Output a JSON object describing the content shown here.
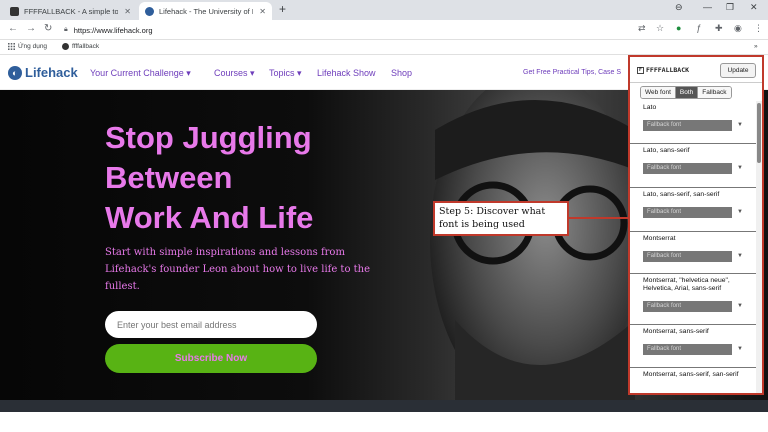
{
  "browser": {
    "tabs": [
      {
        "title": "FFFFALLBACK - A simple tool for",
        "close": "✕"
      },
      {
        "title": "Lifehack - The University of Life",
        "close": "✕"
      }
    ],
    "new_tab": "+",
    "window_controls": [
      "⊖",
      "—",
      "❐",
      "✕"
    ],
    "url": "https://www.lifehack.org",
    "bookmarks": [
      {
        "label": "Ứng dụng"
      },
      {
        "label": "ffffallback"
      }
    ],
    "bookmarks_more": "»"
  },
  "site": {
    "logo_text": "Lifehack",
    "nav": [
      "Your Current Challenge ▾",
      "Courses ▾",
      "Topics ▾",
      "Lifehack Show",
      "Shop"
    ],
    "promo": "Get Free Practical Tips, Case S"
  },
  "hero": {
    "headline": [
      "Stop Juggling",
      "Between",
      "Work And Life"
    ],
    "lead": "Start with simple inspirations and lessons from Lifehack's founder Leon about how to live life to the fullest.",
    "email_placeholder": "Enter your best email address",
    "subscribe": "Subscribe Now"
  },
  "callout": {
    "text": "Step 5: Discover what font is being used"
  },
  "extension": {
    "title": "FFFFALLBACK",
    "update": "Update",
    "tabs": [
      {
        "label": "Web font"
      },
      {
        "label": "Both",
        "active": true
      },
      {
        "label": "Fallback"
      }
    ],
    "fallback_label": "Fallback font",
    "fonts": [
      {
        "name": "Lato"
      },
      {
        "name": "Lato, sans-serif"
      },
      {
        "name": "Lato, sans-serif, san-serif"
      },
      {
        "name": "Montserrat"
      },
      {
        "name": "Montserrat, \"helvetica neue\", Helvetica, Arial, sans-serif"
      },
      {
        "name": "Montserrat, sans-serif"
      },
      {
        "name": "Montserrat, sans-serif, san-serif"
      }
    ]
  },
  "colors": {
    "accent_pink": "#e879ea",
    "nav_purple": "#6e3dbb",
    "logo_blue": "#2f5e9b",
    "subscribe_green": "#58b314",
    "annotation_red": "#c0392b"
  }
}
